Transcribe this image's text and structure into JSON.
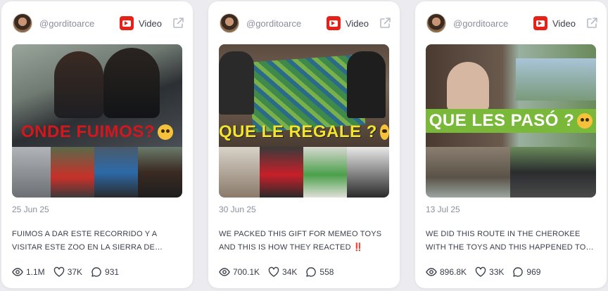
{
  "cards": [
    {
      "handle": "@gorditoarce",
      "type_label": "Video",
      "thumbnail_caption": "ONDE FUIMOS?",
      "date": "25 Jun 25",
      "description": "FUIMOS A DAR ESTE RECORRIDO Y A VISITAR ESTE ZOO EN LA SIERRA DE JALISC...",
      "views": "1.1M",
      "likes": "37K",
      "comments": "931"
    },
    {
      "handle": "@gorditoarce",
      "type_label": "Video",
      "thumbnail_caption": "QUE LE REGALE ?",
      "date": "30 Jun 25",
      "description": "WE PACKED THIS GIFT FOR MEMEO TOYS AND THIS IS HOW THEY REACTED ‼️",
      "views": "700.1K",
      "likes": "34K",
      "comments": "558"
    },
    {
      "handle": "@gorditoarce",
      "type_label": "Video",
      "thumbnail_caption": "QUE LES PASÓ ?",
      "date": "13 Jul 25",
      "description": "WE DID THIS ROUTE IN THE CHEROKEE WITH THE TOYS AND THIS HAPPENED TO THEM...",
      "views": "896.8K",
      "likes": "33K",
      "comments": "969"
    }
  ],
  "icons": {
    "platform": "youtube-icon",
    "external": "external-link-icon",
    "views": "eye-icon",
    "likes": "heart-icon",
    "comments": "comment-icon"
  },
  "colors": {
    "youtube_red": "#e62117",
    "text_muted": "#8a8f9c",
    "text_main": "#3a3f4b",
    "card_bg": "#ffffff",
    "page_bg": "#ececf0"
  }
}
